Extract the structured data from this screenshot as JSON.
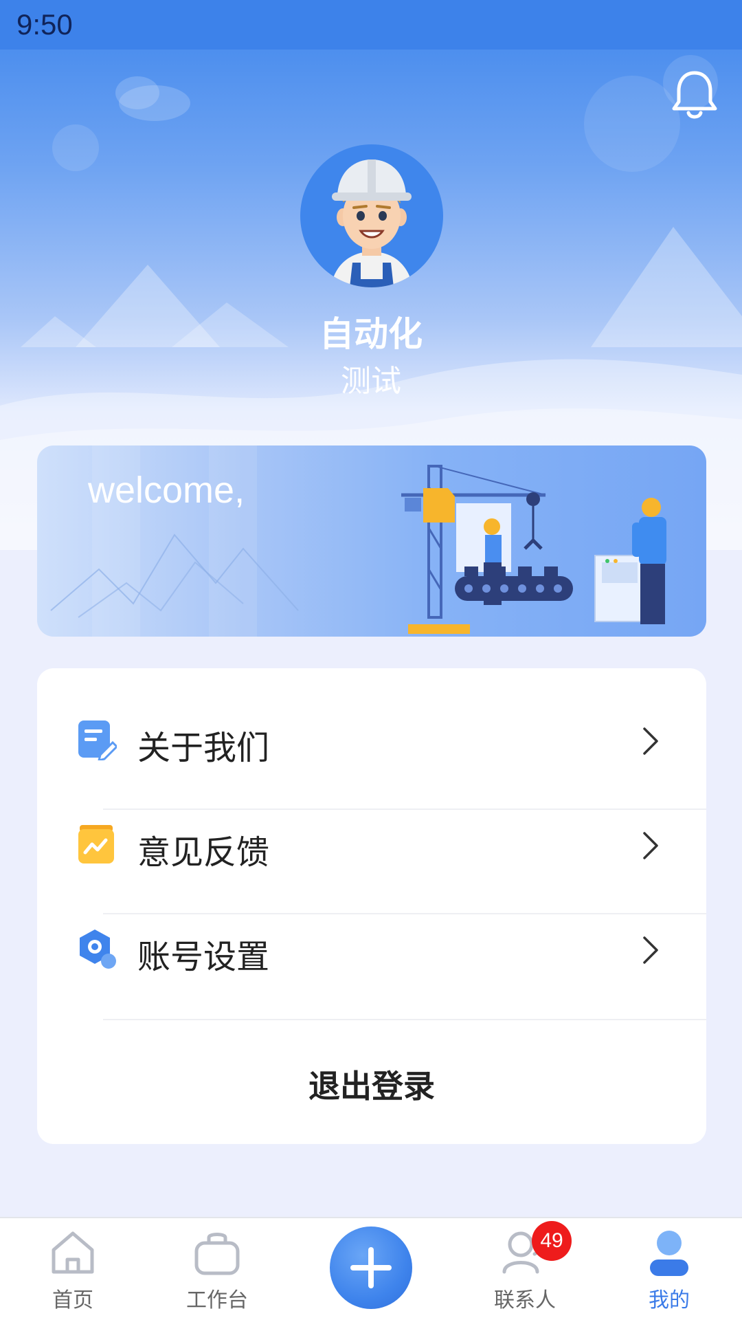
{
  "status_bar": {
    "time": "9:50"
  },
  "header": {
    "notification_icon": "bell-icon",
    "avatar": "worker-avatar",
    "user_name": "自动化",
    "user_role": "测试"
  },
  "banner": {
    "text": "welcome,"
  },
  "menu": {
    "items": [
      {
        "label": "关于我们",
        "icon": "about-doc-icon",
        "color": "#5b9bf4"
      },
      {
        "label": "意见反馈",
        "icon": "feedback-icon",
        "color": "#ffc53d"
      },
      {
        "label": "账号设置",
        "icon": "settings-hex-icon",
        "color": "#3f84ec"
      }
    ],
    "logout_label": "退出登录"
  },
  "bottom_nav": {
    "items": [
      {
        "label": "首页",
        "icon": "home-icon",
        "active": false
      },
      {
        "label": "工作台",
        "icon": "briefcase-icon",
        "active": false
      },
      {
        "label": "",
        "icon": "plus-icon",
        "active": false
      },
      {
        "label": "联系人",
        "icon": "contacts-icon",
        "active": false,
        "badge": "49"
      },
      {
        "label": "我的",
        "icon": "profile-icon",
        "active": true
      }
    ]
  },
  "colors": {
    "primary": "#3f84ec",
    "active_tab": "#3b7be8",
    "badge": "#ee1c1c"
  }
}
